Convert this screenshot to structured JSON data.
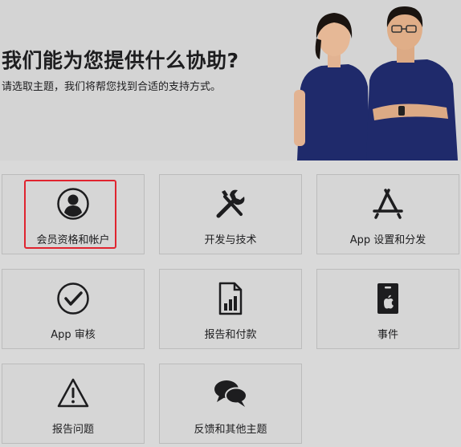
{
  "hero": {
    "title": "我们能为您提供什么协助?",
    "subtitle": "请选取主题，我们将帮您找到合适的支持方式。"
  },
  "topics": [
    {
      "label": "会员资格和帐户",
      "icon": "person-circle-icon"
    },
    {
      "label": "开发与技术",
      "icon": "tools-icon"
    },
    {
      "label": "App 设置和分发",
      "icon": "app-store-icon"
    },
    {
      "label": "App 审核",
      "icon": "checkmark-circle-icon"
    },
    {
      "label": "报告和付款",
      "icon": "chart-document-icon"
    },
    {
      "label": "事件",
      "icon": "apple-badge-icon"
    },
    {
      "label": "报告问题",
      "icon": "warning-triangle-icon"
    },
    {
      "label": "反馈和其他主题",
      "icon": "speech-bubbles-icon"
    }
  ],
  "highlight_color": "#e0242f"
}
